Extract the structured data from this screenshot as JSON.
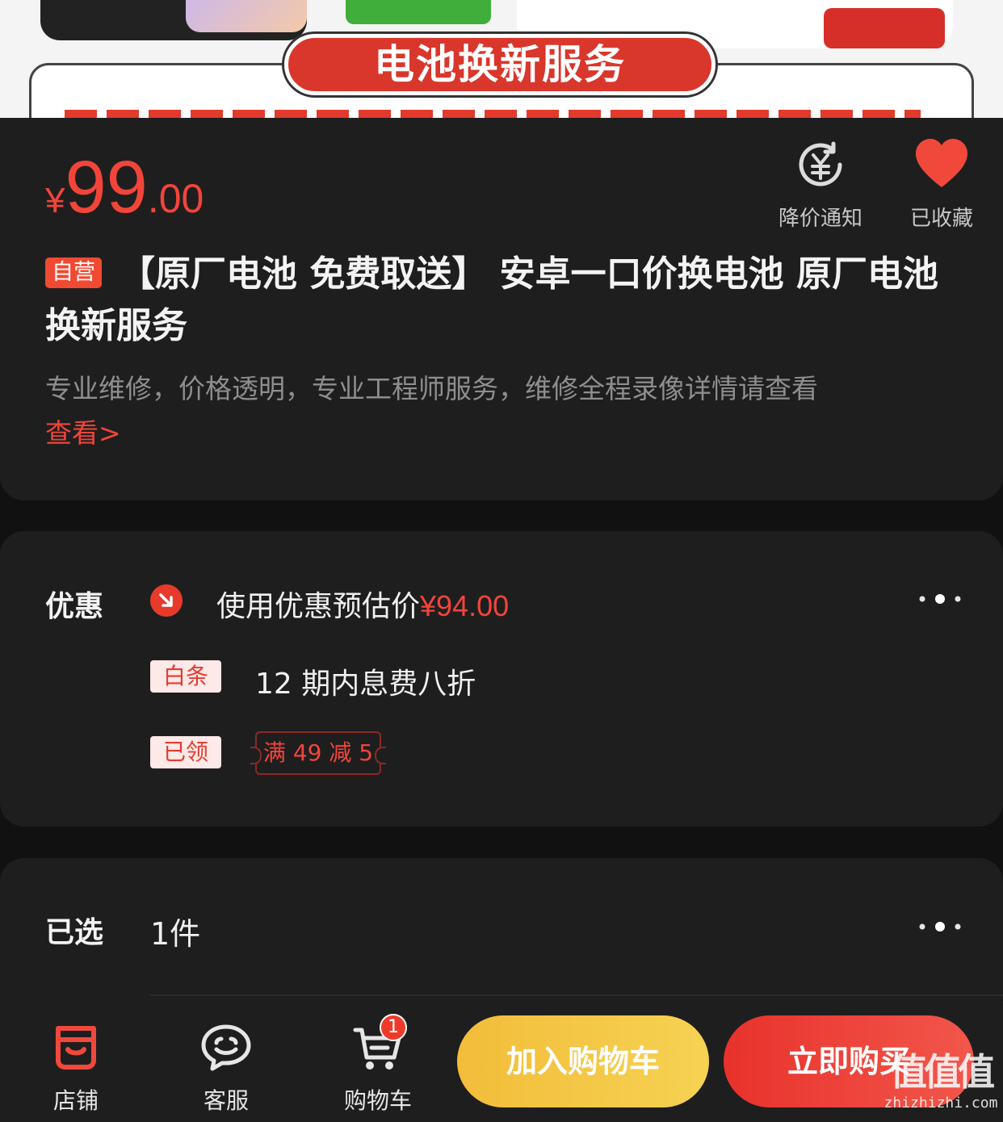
{
  "banner": {
    "service_title": "电池换新服务"
  },
  "product": {
    "price_currency": "¥",
    "price_integer": "99",
    "price_decimal": ".00",
    "self_operated_tag": "自营",
    "title": "【原厂电池 免费取送】 安卓一口价换电池 原厂电池换新服务",
    "description": "专业维修，价格透明，专业工程师服务，维修全程录像详情请查看",
    "more_link": "查看>"
  },
  "actions": {
    "price_alert": "降价通知",
    "favorited": "已收藏"
  },
  "promotions": {
    "label": "优惠",
    "estimate_text": "使用优惠预估价",
    "estimate_price": "¥94.00",
    "baitiao_tag": "白条",
    "baitiao_text": "12 期内息费八折",
    "claimed_tag": "已领",
    "coupon_text": "满 49 减 5"
  },
  "selection": {
    "label": "已选",
    "value": "1件"
  },
  "bottom_bar": {
    "shop": "店铺",
    "service": "客服",
    "cart": "购物车",
    "cart_count": "1",
    "add_to_cart": "加入购物车",
    "buy_now": "立即购买"
  },
  "watermark": {
    "main": "值值值",
    "sub": "zhizhizhi.com"
  },
  "colors": {
    "accent_red": "#f2453a",
    "yellow": "#f2bd3a",
    "card_bg": "#1f1e1f"
  },
  "icons": [
    "price-alert-icon",
    "heart-icon",
    "price-down-icon",
    "more-dots-icon",
    "shop-icon",
    "service-icon",
    "cart-icon"
  ]
}
